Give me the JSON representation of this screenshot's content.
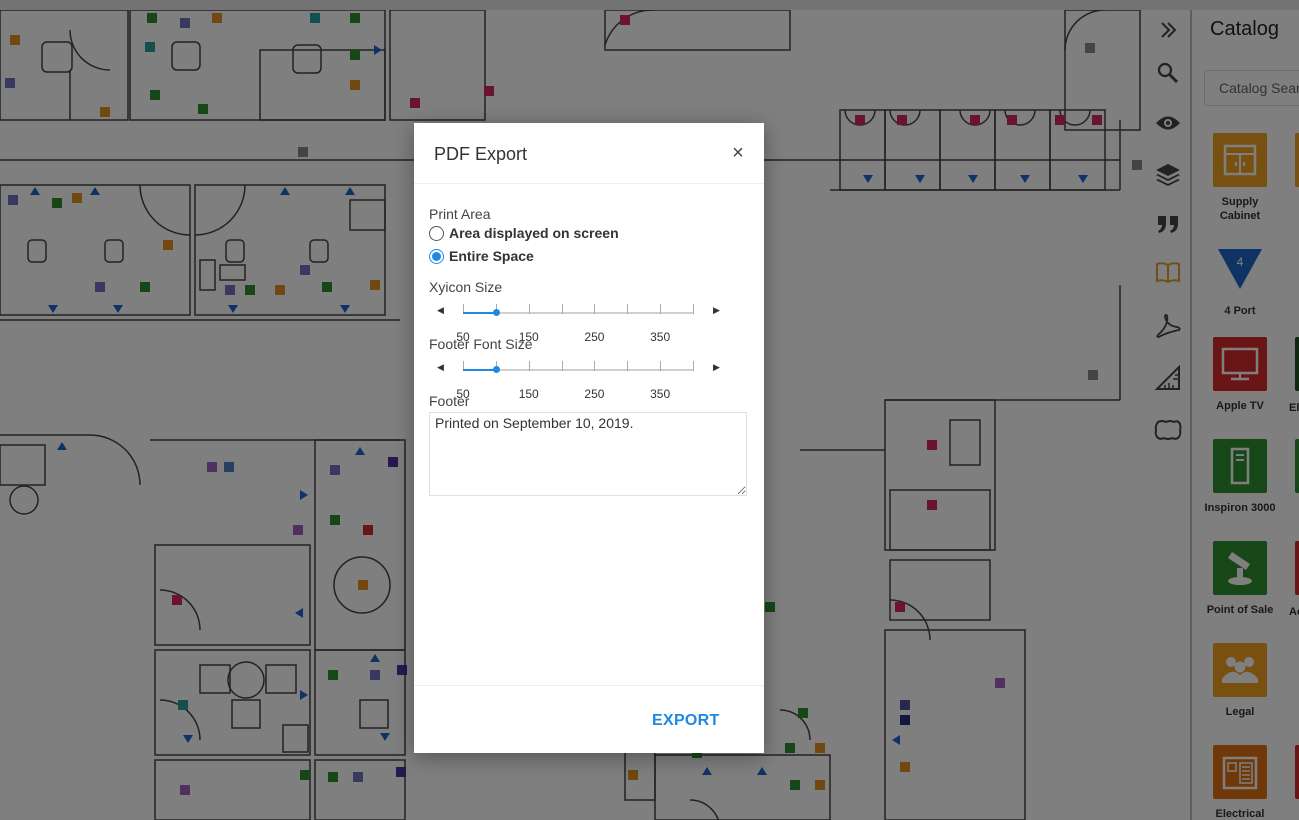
{
  "catalog": {
    "title": "Catalog",
    "search_placeholder": "Catalog Search",
    "items": [
      {
        "label": "Supply Cabinet",
        "color": "#f0a020",
        "icon": "cabinet-icon"
      },
      {
        "label": "4 Port",
        "color": "#1e66c8",
        "icon": "port-icon",
        "badge": "4"
      },
      {
        "label": "Apple TV",
        "color": "#d42a2a",
        "icon": "tv-icon"
      },
      {
        "label": "Inspiron 3000",
        "color": "#2f8f2f",
        "icon": "computer-tower-icon"
      },
      {
        "label": "Point of Sale",
        "color": "#2f8f2f",
        "icon": "pos-icon"
      },
      {
        "label": "Legal",
        "color": "#f0a020",
        "icon": "group-icon"
      },
      {
        "label": "Electrical",
        "color": "#e07010",
        "icon": "electrical-panel-icon"
      }
    ],
    "peek_labels": [
      "Eli",
      "Ac"
    ]
  },
  "toolbar": {
    "tools": [
      {
        "name": "collapse-icon"
      },
      {
        "name": "search-icon"
      },
      {
        "name": "eye-icon"
      },
      {
        "name": "layers-icon"
      },
      {
        "name": "quote-icon"
      },
      {
        "name": "book-icon"
      },
      {
        "name": "pdf-icon"
      },
      {
        "name": "ruler-icon"
      },
      {
        "name": "shape-icon"
      }
    ]
  },
  "dialog": {
    "title": "PDF Export",
    "close": "×",
    "print_area_label": "Print Area",
    "options": [
      {
        "label": "Area displayed on screen",
        "checked": false
      },
      {
        "label": "Entire Space",
        "checked": true
      }
    ],
    "xyicon_size": {
      "label": "Xyicon Size",
      "ticks": [
        "50",
        "150",
        "250",
        "350"
      ],
      "value": 100,
      "min": 50,
      "max": 400
    },
    "footer_font_size": {
      "label": "Footer Font Size",
      "ticks": [
        "50",
        "150",
        "250",
        "350"
      ],
      "value": 100,
      "min": 50,
      "max": 400
    },
    "footer_label": "Footer",
    "footer_value": "Printed on September 10, 2019.",
    "export_label": "EXPORT"
  }
}
